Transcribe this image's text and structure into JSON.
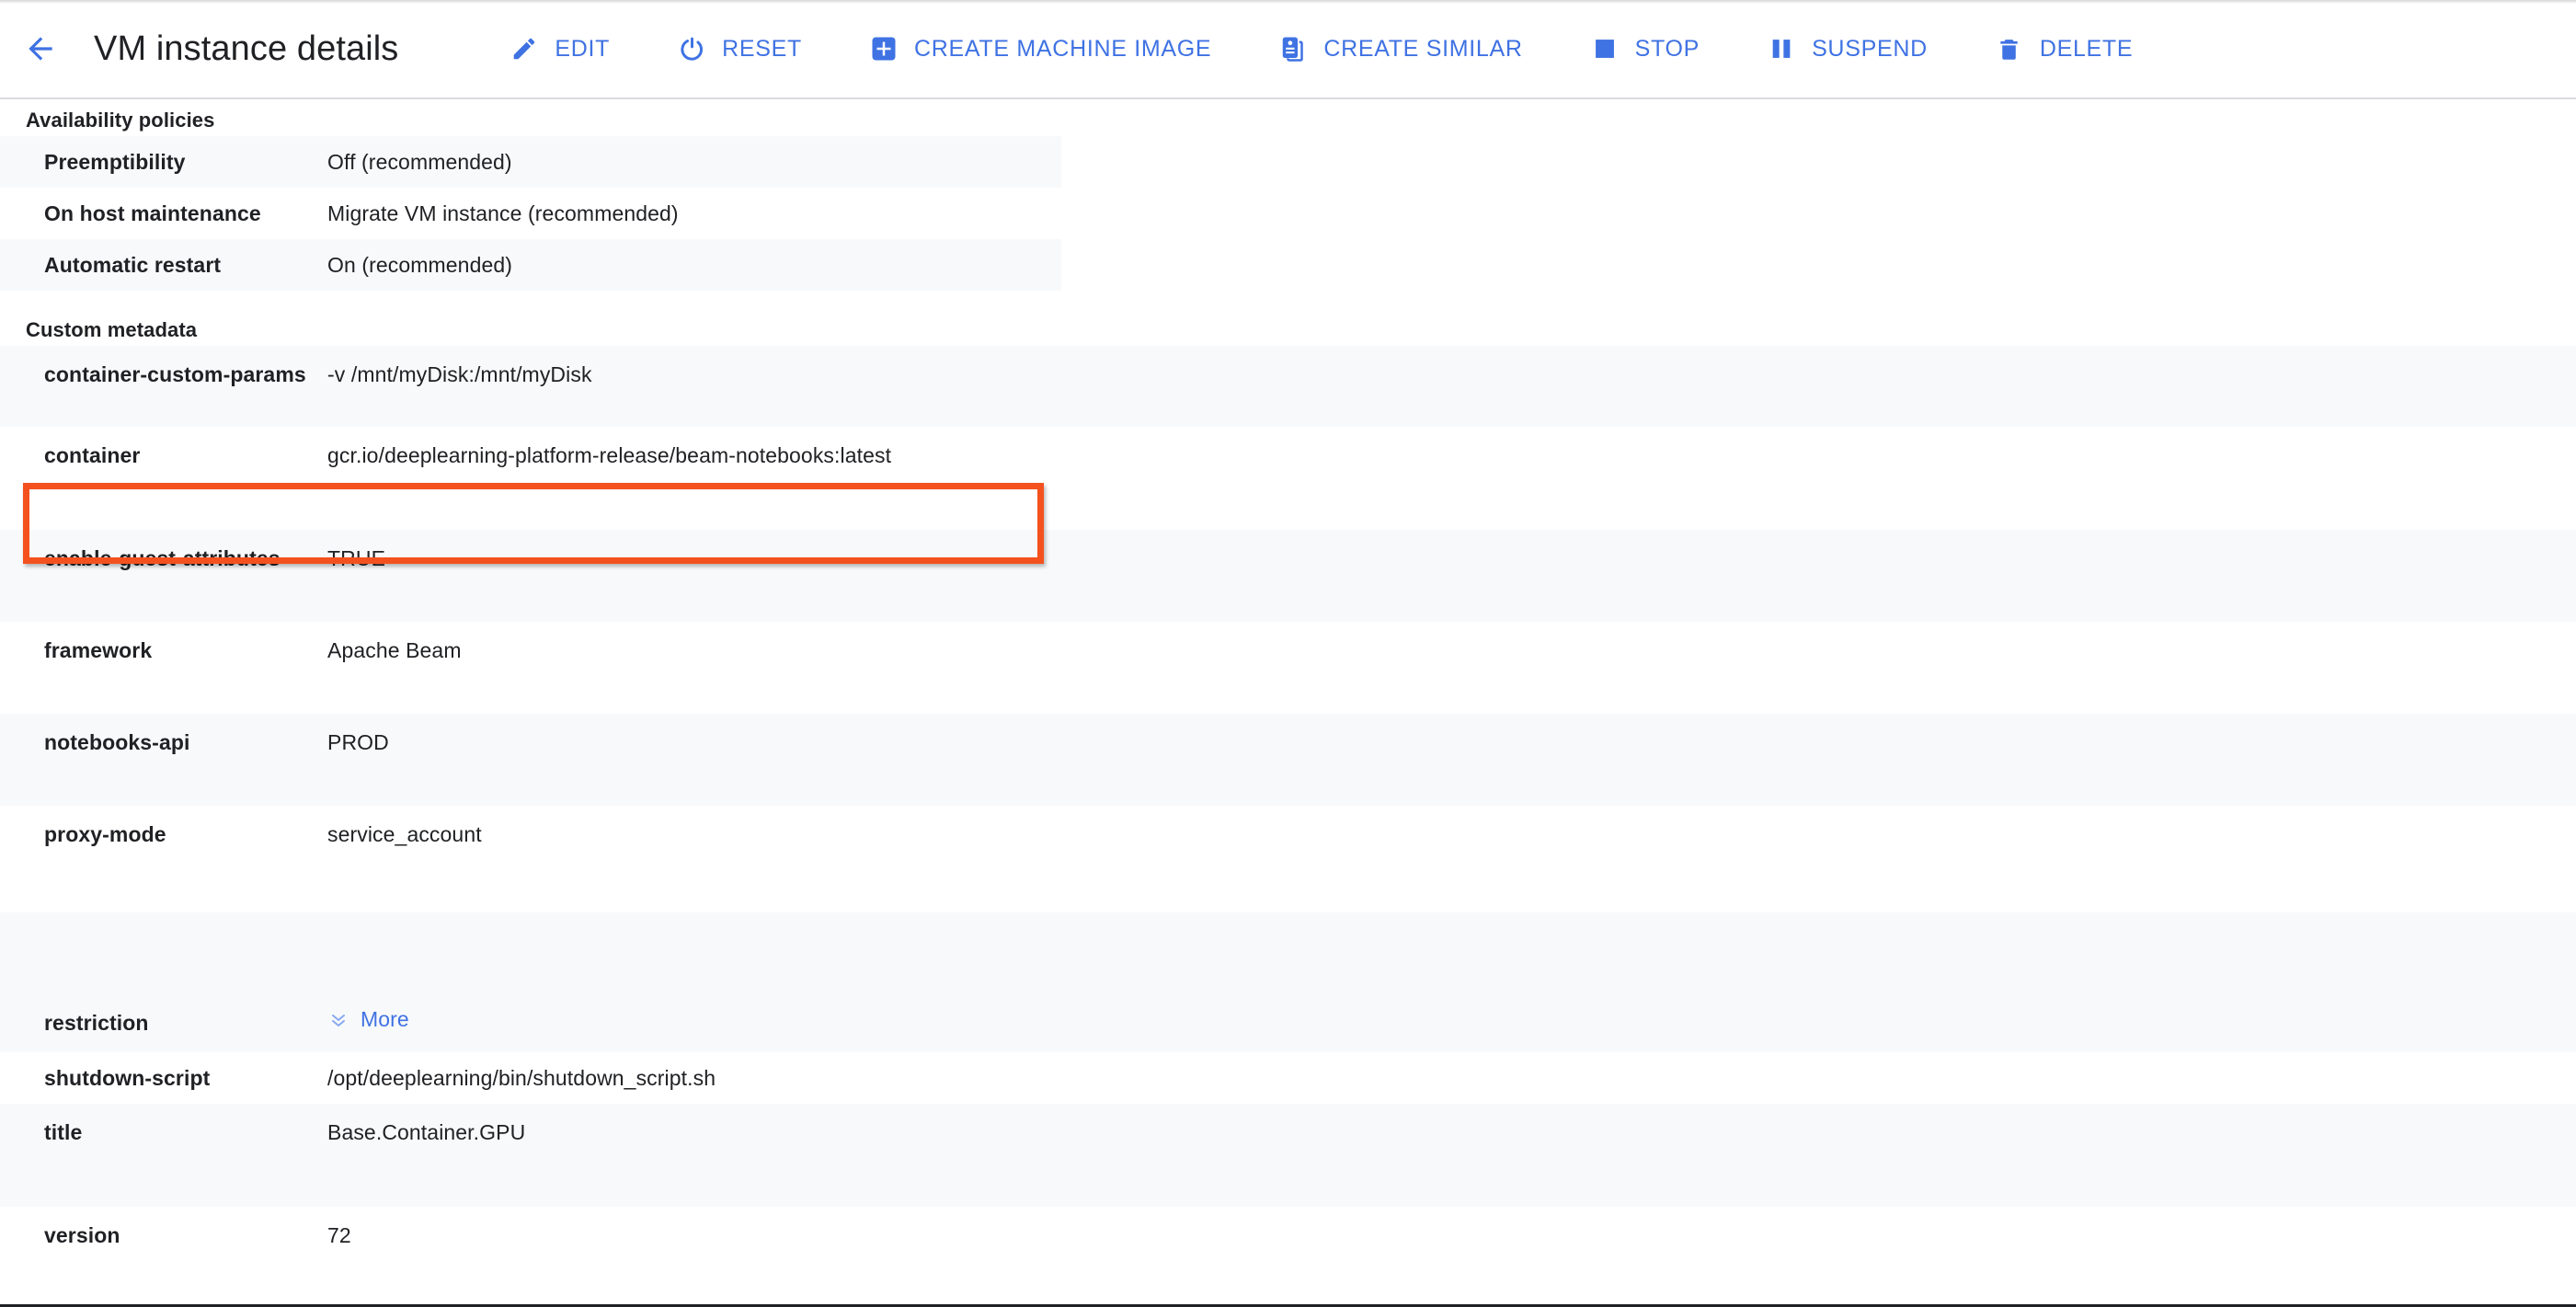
{
  "header": {
    "back_icon": "arrow-back-icon",
    "title": "VM instance details",
    "accent_color": "#3f72e3",
    "buttons": [
      {
        "label": "EDIT",
        "icon": "pencil-icon"
      },
      {
        "label": "RESET",
        "icon": "power-reset-icon"
      },
      {
        "label": "CREATE MACHINE IMAGE",
        "icon": "plus-square-icon"
      },
      {
        "label": "CREATE SIMILAR",
        "icon": "copy-document-icon"
      },
      {
        "label": "STOP",
        "icon": "stop-square-icon"
      },
      {
        "label": "SUSPEND",
        "icon": "pause-bars-icon"
      },
      {
        "label": "DELETE",
        "icon": "trash-icon"
      }
    ]
  },
  "availability_policies": {
    "title": "Availability policies",
    "rows": [
      {
        "key": "Preemptibility",
        "value": "Off (recommended)"
      },
      {
        "key": "On host maintenance",
        "value": "Migrate VM instance (recommended)"
      },
      {
        "key": "Automatic restart",
        "value": "On (recommended)"
      }
    ]
  },
  "custom_metadata": {
    "title": "Custom metadata",
    "rows": [
      {
        "key": "container-custom-params",
        "value": "-v /mnt/myDisk:/mnt/myDisk",
        "height": 88,
        "highlighted": true
      },
      {
        "key": "container",
        "value": "gcr.io/deeplearning-platform-release/beam-notebooks:latest",
        "height": 112
      },
      {
        "key": "enable-guest-attributes",
        "value": "TRUE",
        "height": 100
      },
      {
        "key": "framework",
        "value": "Apache Beam",
        "height": 100
      },
      {
        "key": "notebooks-api",
        "value": "PROD",
        "height": 100
      },
      {
        "key": "proxy-mode",
        "value": "service_account",
        "height": 116
      },
      {
        "key": "restriction",
        "value": "More",
        "height": 152,
        "is_link": true,
        "link_icon": "double-chevron-down-icon"
      },
      {
        "key": "shutdown-script",
        "value": "/opt/deeplearning/bin/shutdown_script.sh",
        "height": 56
      },
      {
        "key": "title",
        "value": "Base.Container.GPU",
        "height": 112
      },
      {
        "key": "version",
        "value": "72",
        "height": 60
      }
    ]
  },
  "highlight": {
    "color": "#f4511e",
    "target": "container-custom-params"
  }
}
